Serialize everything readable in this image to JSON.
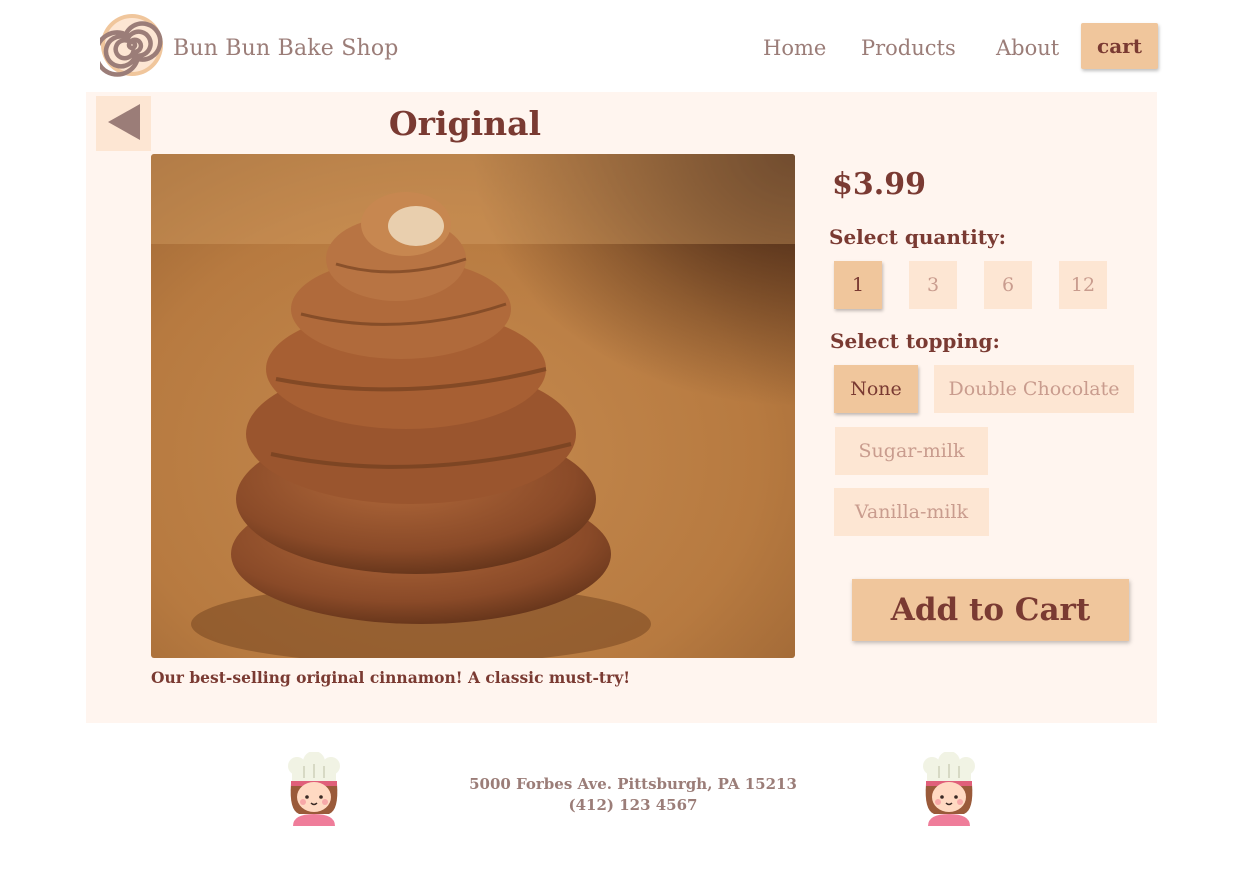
{
  "header": {
    "brand": "Bun Bun Bake Shop",
    "nav": [
      "Home",
      "Products",
      "About"
    ],
    "cart_label": "cart"
  },
  "product": {
    "title": "Original",
    "price": "$3.99",
    "description": "Our best-selling original cinnamon! A classic must-try!",
    "quantity_label": "Select quantity:",
    "quantities": [
      "1",
      "3",
      "6",
      "12"
    ],
    "selected_quantity": "1",
    "topping_label": "Select topping:",
    "toppings": [
      "None",
      "Double Chocolate",
      "Sugar-milk",
      "Vanilla-milk"
    ],
    "selected_topping": "None",
    "add_to_cart_label": "Add to Cart"
  },
  "footer": {
    "address": "5000 Forbes Ave. Pittsburgh, PA 15213",
    "phone": "(412) 123 4567"
  },
  "icons": [
    "logo-swirl-icon",
    "back-arrow-icon",
    "chef-icon"
  ],
  "colors": {
    "accent": "#f0c69c",
    "accent_light": "#fde6d3",
    "panel_bg": "#fff5ef",
    "text_dark": "#7a3a32",
    "text_muted": "#9b7d78"
  }
}
